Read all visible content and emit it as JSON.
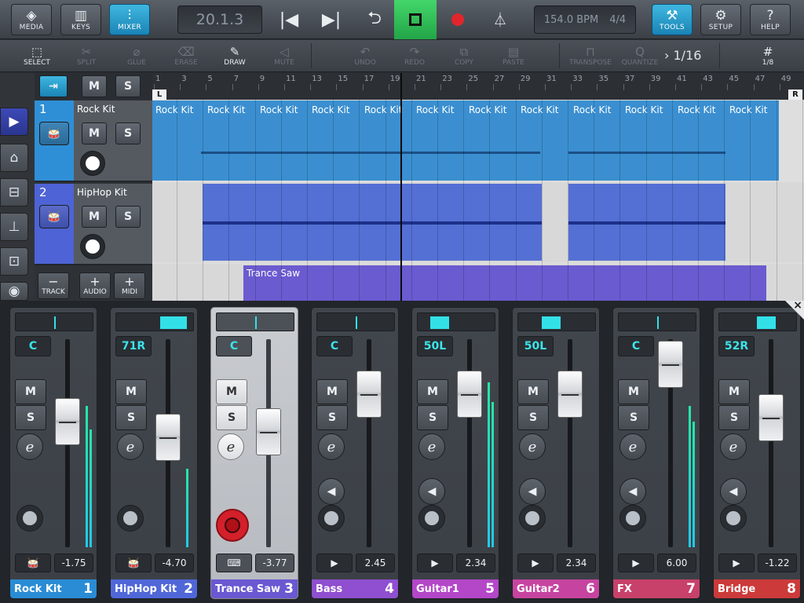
{
  "topbar": {
    "buttons": [
      {
        "label": "MEDIA",
        "icon": "media-icon"
      },
      {
        "label": "KEYS",
        "icon": "keys-icon"
      },
      {
        "label": "MIXER",
        "icon": "mixer-icon",
        "active": true
      },
      {
        "label": "TOOLS",
        "icon": "hammer-icon",
        "active": true
      },
      {
        "label": "SETUP",
        "icon": "gear-icon"
      },
      {
        "label": "HELP",
        "icon": "help-icon"
      }
    ],
    "position": "20.1.3",
    "tempo": "154.0 BPM",
    "signature": "4/4"
  },
  "toolbar": {
    "tools": [
      "SELECT",
      "SPLIT",
      "GLUE",
      "ERASE",
      "DRAW",
      "MUTE",
      "UNDO",
      "REDO",
      "COPY",
      "PASTE",
      "TRANSPOSE",
      "QUANTIZE"
    ],
    "quantize_value": "1/16",
    "grid_value": "1/8"
  },
  "tracklist": {
    "header_buttons": [
      "M",
      "S"
    ],
    "tracks": [
      {
        "number": "1",
        "name": "Rock Kit"
      },
      {
        "number": "2",
        "name": "HipHop Kit"
      }
    ],
    "bottom_buttons": [
      {
        "symbol": "−",
        "label": "TRACK"
      },
      {
        "symbol": "+",
        "label": "AUDIO"
      },
      {
        "symbol": "+",
        "label": "MIDI"
      }
    ]
  },
  "ruler": {
    "bars": [
      "1",
      "3",
      "5",
      "7",
      "9",
      "11",
      "13",
      "15",
      "17",
      "19",
      "21",
      "23",
      "25",
      "27",
      "29",
      "31",
      "33",
      "35",
      "37",
      "39",
      "41",
      "43",
      "45",
      "47",
      "49"
    ],
    "left_locator": "L",
    "right_locator": "R"
  },
  "parts": {
    "rock_label": "Rock Kit",
    "trance_label": "Trance Saw"
  },
  "mixer": {
    "buttons": {
      "mute": "M",
      "solo": "S",
      "edit": "e"
    },
    "channels": [
      {
        "name": "Rock Kit",
        "number": "1",
        "pan": "C",
        "volume": "-1.75",
        "type_icon": "drum-icon",
        "color": "#2a8cd4"
      },
      {
        "name": "HipHop Kit",
        "number": "2",
        "pan": "71R",
        "volume": "-4.70",
        "type_icon": "drum-icon",
        "color": "#5067d8"
      },
      {
        "name": "Trance Saw",
        "number": "3",
        "pan": "C",
        "volume": "-3.77",
        "type_icon": "synth-icon",
        "color": "#6a58d2"
      },
      {
        "name": "Bass",
        "number": "4",
        "pan": "C",
        "volume": "2.45",
        "type_icon": "play-icon",
        "color": "#8f4fd0"
      },
      {
        "name": "Guitar1",
        "number": "5",
        "pan": "50L",
        "volume": "2.34",
        "type_icon": "play-icon",
        "color": "#b347c8"
      },
      {
        "name": "Guitar2",
        "number": "6",
        "pan": "50L",
        "volume": "2.34",
        "type_icon": "play-icon",
        "color": "#c6449f"
      },
      {
        "name": "FX",
        "number": "7",
        "pan": "C",
        "volume": "6.00",
        "type_icon": "play-icon",
        "color": "#c8416a"
      },
      {
        "name": "Bridge",
        "number": "8",
        "pan": "52R",
        "volume": "-1.22",
        "type_icon": "play-icon",
        "color": "#cc3a3a"
      }
    ],
    "close_symbol": "×"
  }
}
